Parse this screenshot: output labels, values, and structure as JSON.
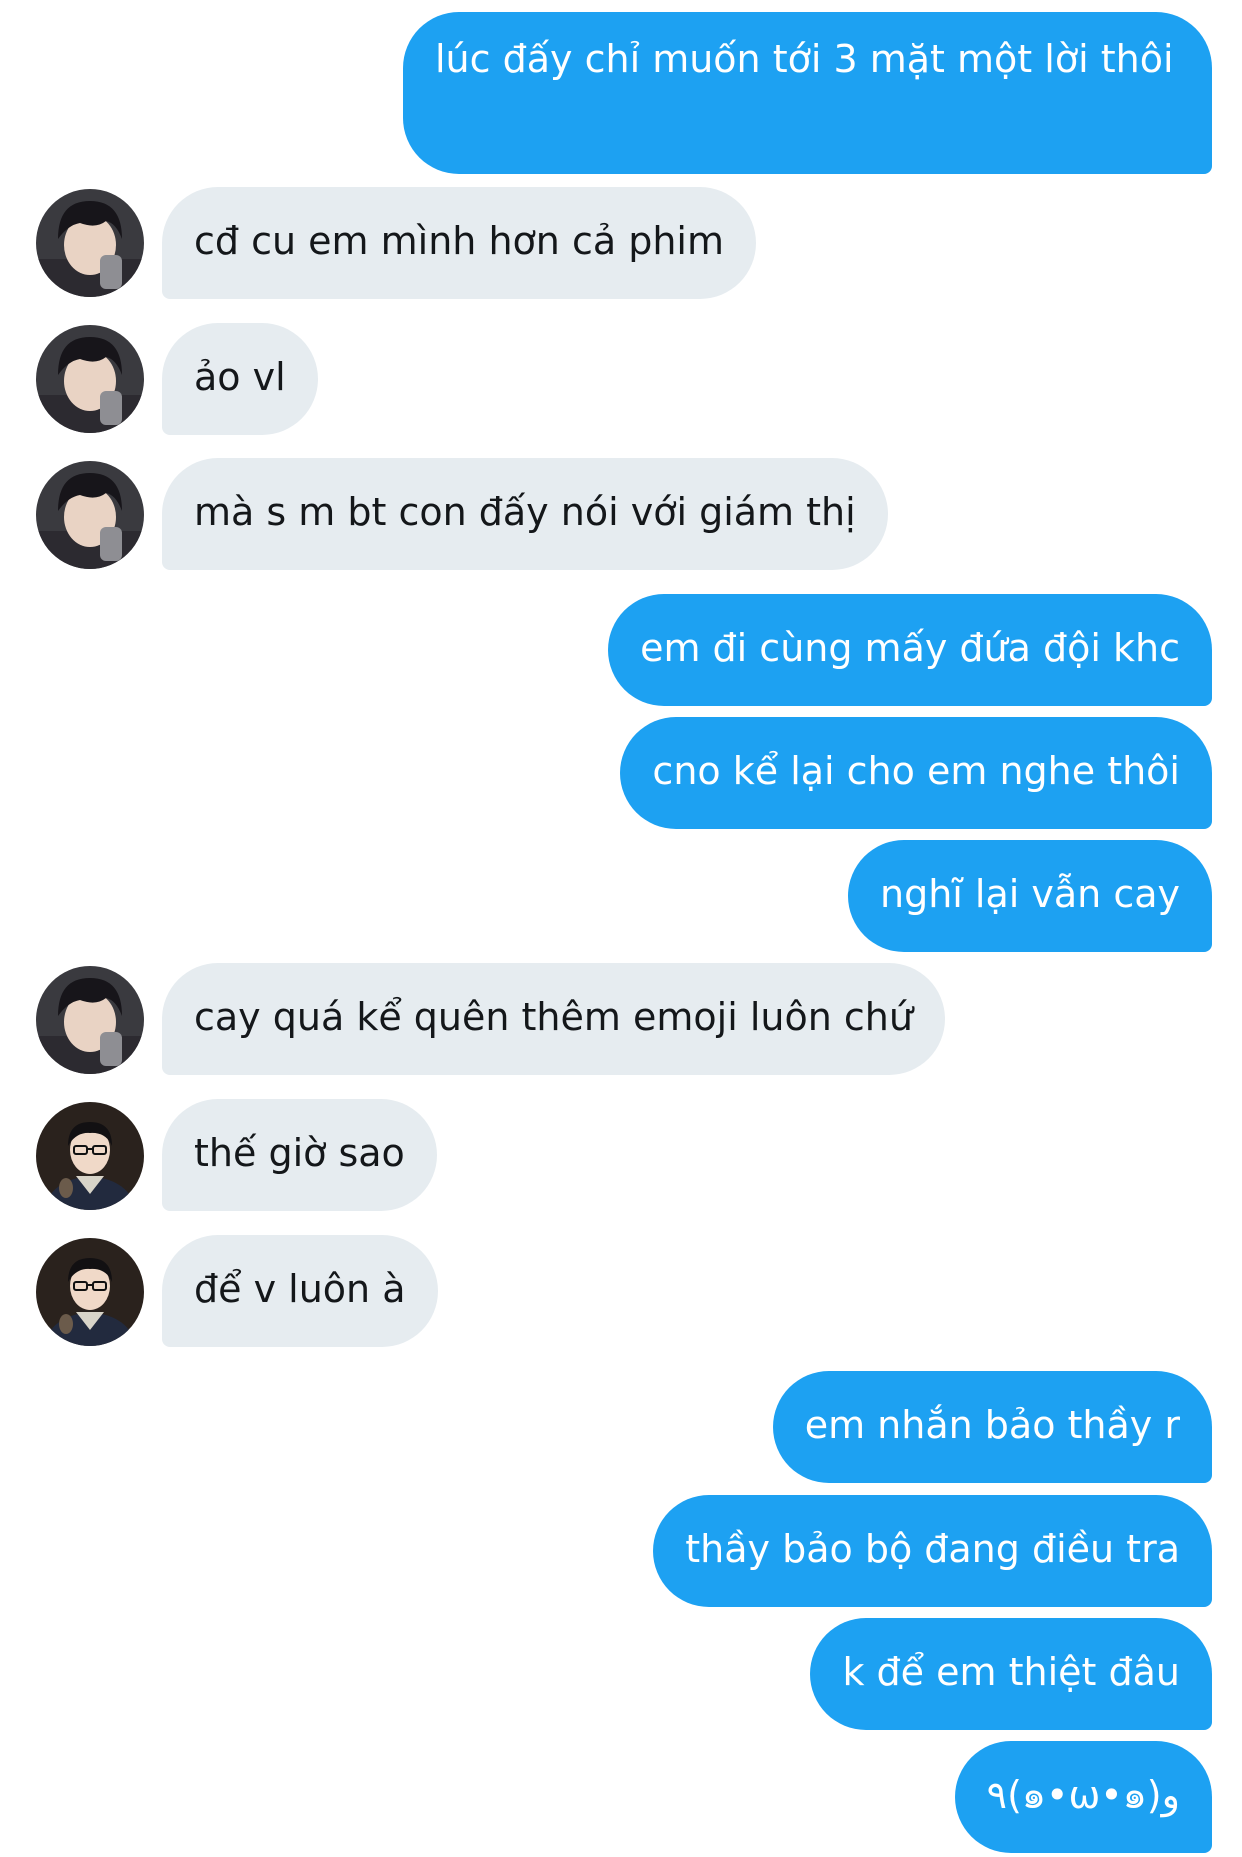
{
  "conversation": {
    "messages": [
      {
        "sender": "me",
        "text": "lúc đấy chỉ muốn tới 3 mặt một lời thôi"
      },
      {
        "sender": "other",
        "avatar": "user-a-avatar",
        "text": "cđ cu em mình hơn cả phim"
      },
      {
        "sender": "other",
        "avatar": "user-a-avatar",
        "text": "ảo vl"
      },
      {
        "sender": "other",
        "avatar": "user-a-avatar",
        "text": "mà s m bt con đấy nói với giám thị"
      },
      {
        "sender": "me",
        "text": "em đi cùng mấy đứa đội khc"
      },
      {
        "sender": "me",
        "text": "cno kể lại cho em nghe thôi"
      },
      {
        "sender": "me",
        "text": "nghĩ lại vẫn cay"
      },
      {
        "sender": "other",
        "avatar": "user-a-avatar",
        "text": "cay quá kể quên thêm emoji luôn chứ"
      },
      {
        "sender": "other",
        "avatar": "user-b-avatar",
        "text": "thế giờ sao"
      },
      {
        "sender": "other",
        "avatar": "user-b-avatar",
        "text": "để v luôn à"
      },
      {
        "sender": "me",
        "text": "em nhắn bảo thầy r"
      },
      {
        "sender": "me",
        "text": "thầy bảo bộ đang điều tra"
      },
      {
        "sender": "me",
        "text": "k để em thiệt đâu"
      },
      {
        "sender": "me",
        "text": "٩(๑•ω•๑)و"
      }
    ]
  },
  "colors": {
    "outgoing_bubble": "#1da1f2",
    "incoming_bubble": "#e6ecf0",
    "outgoing_text": "#ffffff",
    "incoming_text": "#14171a"
  }
}
